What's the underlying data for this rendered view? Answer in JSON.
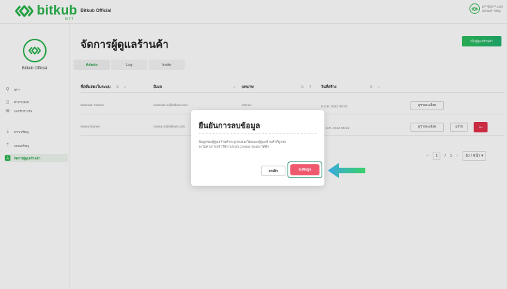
{
  "topbar": {
    "brand": "bitkub",
    "brand_sub": "NFT",
    "title": "Bitkub Official",
    "account_email": "p***@g***.com",
    "account_name": "School - fahg"
  },
  "sidebar": {
    "name": "Bitkub Official",
    "items": [
      {
        "label": "NFT",
        "icon": "bag-icon"
      },
      {
        "label": "ศาลาปล่อย",
        "icon": "document-icon"
      },
      {
        "label": "แลกรับรางวัล",
        "icon": "gift-icon"
      },
      {
        "label": "ฝากเหรียญ",
        "icon": "download-icon"
      },
      {
        "label": "ถอนเหรียญ",
        "icon": "upload-icon"
      },
      {
        "label": "จัดการผู้ดูแลร้านค้า",
        "icon": "user-manage-icon"
      }
    ]
  },
  "main": {
    "title": "จัดการผู้ดูแลร้านค้า",
    "add_button": "เพิ่มผู้ดูแลร้านค้า",
    "tabs": [
      "Admin",
      "Log",
      "Invite"
    ],
    "columns": [
      "ชื่อที่แสดงในระบบ",
      "อีเมล",
      "บทบาท",
      "วันที่สร้าง"
    ],
    "rows": [
      {
        "name": "Manode Kantee",
        "email": "manode.k@bitkub.com",
        "role": "Owner",
        "created": "9 ม.ค. 2022 08:32",
        "actions": [
          "ดูรายละเอียด"
        ]
      },
      {
        "name": "Mana Manee",
        "email": "mana.m@bitkub.com",
        "role": "Admin",
        "created": "18 ม.ค. 2022 08:32",
        "actions": [
          "ดูรายละเอียด",
          "แก้ไข",
          "ลบ"
        ]
      }
    ],
    "pagination": {
      "prev": "<",
      "page": "1",
      "sep": "/",
      "total": "1",
      "next": ">",
      "per_page": "10 / หน้า"
    }
  },
  "modal": {
    "title": "ยืนยันการลบข้อมูล",
    "body_line1": "ข้อมูลของผู้ดูแลร้านค้าจะถูกลบออกโดยและผู้ดูแลร้านค้าที่ถูกลบ",
    "body_line2": "จะไม่สามารถเข้าใช้งานระบบ Creator Studio ได้อีก",
    "cancel": "ยกเลิก",
    "confirm": "ลบข้อมูล"
  },
  "colors": {
    "brand": "#27b34b",
    "danger": "#ef5a6e",
    "highlight": "#2b8e74"
  }
}
